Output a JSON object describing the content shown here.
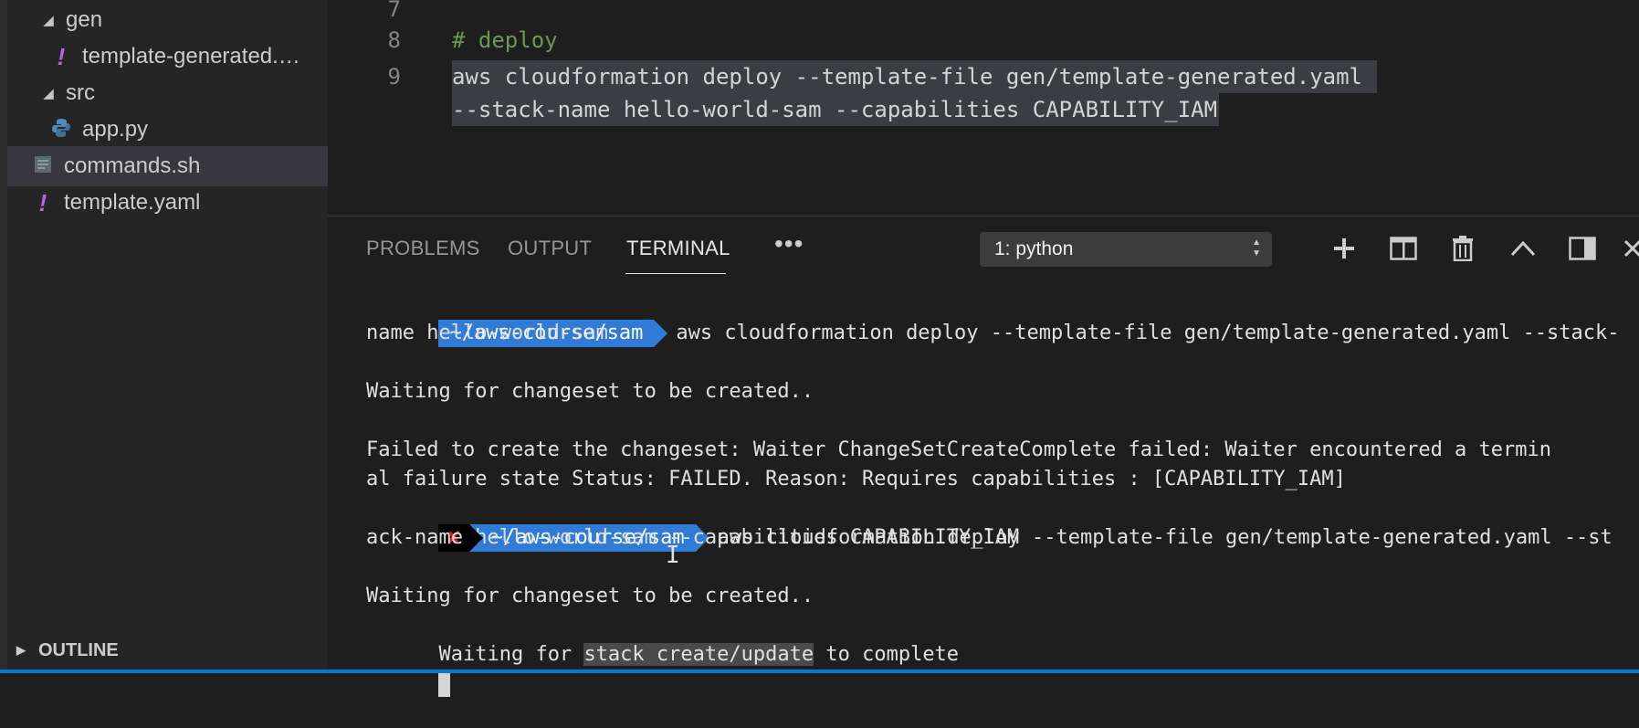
{
  "explorer": {
    "items": [
      {
        "label": "gen",
        "type": "folder"
      },
      {
        "label": "template-generated.…",
        "type": "yaml"
      },
      {
        "label": "src",
        "type": "folder"
      },
      {
        "label": "app.py",
        "type": "python"
      },
      {
        "label": "commands.sh",
        "type": "shell"
      },
      {
        "label": "template.yaml",
        "type": "yaml"
      }
    ],
    "outline_label": "OUTLINE"
  },
  "editor": {
    "lines": [
      {
        "num": "7",
        "text": ""
      },
      {
        "num": "8",
        "text": "# deploy"
      },
      {
        "num": "9",
        "text": "aws cloudformation deploy --template-file gen/template-generated.yaml "
      },
      {
        "num": "",
        "text": "--stack-name hello-world-sam --capabilities CAPABILITY_IAM"
      }
    ]
  },
  "panel": {
    "tabs": [
      "PROBLEMS",
      "OUTPUT",
      "TERMINAL"
    ],
    "active_tab": "TERMINAL",
    "more": "•••",
    "terminal_select": "1: python"
  },
  "terminal": {
    "prompt_path": "~/aws-course/sam",
    "error_mark": "✘",
    "cmd1_a": "aws cloudformation deploy --template-file gen/template-generated.yaml --stack-",
    "cmd1_b": "name hello-world-sam",
    "waiting1": "Waiting for changeset to be created..",
    "fail_a": "Failed to create the changeset: Waiter ChangeSetCreateComplete failed: Waiter encountered a termin",
    "fail_b": "al failure state Status: FAILED. Reason: Requires capabilities : [CAPABILITY_IAM]",
    "cmd2_a": "aws cloudformation deploy --template-file gen/template-generated.yaml --st",
    "cmd2_b": "ack-name hello-world-sam --capabilities CAPABILITY_IAM",
    "waiting2": "Waiting for changeset to be created..",
    "waiting3_pre": "Waiting for ",
    "waiting3_hl": "stack create/update",
    "waiting3_post": " to complete"
  },
  "colors": {
    "prompt_bg": "#2f7bd6",
    "error": "#e02020",
    "comment": "#6a9955",
    "yaml_icon": "#b267e6",
    "python_icon": "#4b8bbe"
  }
}
